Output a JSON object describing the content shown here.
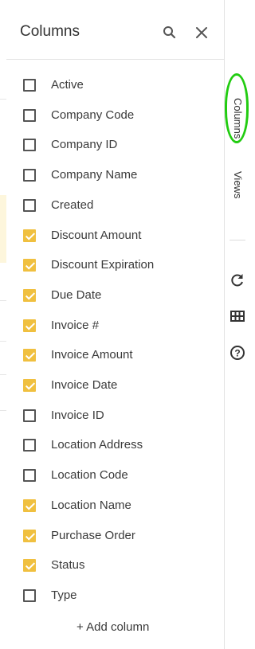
{
  "panel": {
    "title": "Columns",
    "add_label": "+ Add column"
  },
  "columns": [
    {
      "label": "Active",
      "checked": false
    },
    {
      "label": "Company Code",
      "checked": false
    },
    {
      "label": "Company ID",
      "checked": false
    },
    {
      "label": "Company Name",
      "checked": false
    },
    {
      "label": "Created",
      "checked": false
    },
    {
      "label": "Discount Amount",
      "checked": true
    },
    {
      "label": "Discount Expiration",
      "checked": true
    },
    {
      "label": "Due Date",
      "checked": true
    },
    {
      "label": "Invoice #",
      "checked": true
    },
    {
      "label": "Invoice Amount",
      "checked": true
    },
    {
      "label": "Invoice Date",
      "checked": true
    },
    {
      "label": "Invoice ID",
      "checked": false
    },
    {
      "label": "Location Address",
      "checked": false
    },
    {
      "label": "Location Code",
      "checked": false
    },
    {
      "label": "Location Name",
      "checked": true
    },
    {
      "label": "Purchase Order",
      "checked": true
    },
    {
      "label": "Status",
      "checked": true
    },
    {
      "label": "Type",
      "checked": false
    }
  ],
  "rail": {
    "columns_label": "Columns",
    "views_label": "Views"
  },
  "colors": {
    "checked": "#f0c040",
    "highlight_ring": "#22cc11"
  },
  "icons": {
    "search": "search-icon",
    "close": "close-icon",
    "refresh": "refresh-icon",
    "grid": "grid-icon",
    "help": "help-icon"
  }
}
